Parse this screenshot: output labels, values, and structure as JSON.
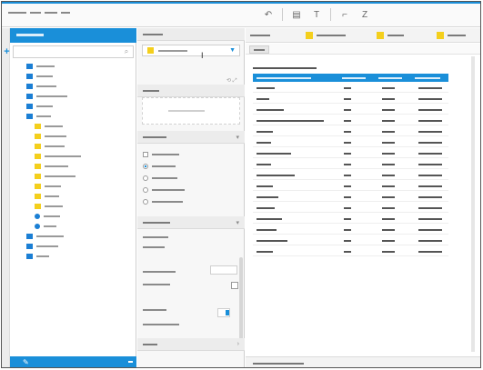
{
  "colors": {
    "accent": "#1a8fd9",
    "folder": "#1b7fd4",
    "field": "#f4cf1c",
    "legend": [
      "#f4cf1c",
      "#f4cf1c",
      "#f4cf1c"
    ]
  },
  "icons": {
    "add": "plus-icon",
    "search": "search-icon",
    "folder": "folder-icon",
    "field": "field-icon",
    "measure": "measure-icon",
    "edit": "pencil-icon",
    "dropdown": "chevron-down-icon"
  },
  "data_panel": {
    "search_placeholder": "",
    "tree": [
      {
        "type": "folder",
        "indent": 0
      },
      {
        "type": "folder",
        "indent": 0
      },
      {
        "type": "folder",
        "indent": 0
      },
      {
        "type": "folder",
        "indent": 0
      },
      {
        "type": "folder",
        "indent": 0
      },
      {
        "type": "folder",
        "indent": 0
      },
      {
        "type": "field",
        "indent": 1
      },
      {
        "type": "field",
        "indent": 1
      },
      {
        "type": "field",
        "indent": 1
      },
      {
        "type": "field",
        "indent": 1
      },
      {
        "type": "field",
        "indent": 1
      },
      {
        "type": "field",
        "indent": 1
      },
      {
        "type": "field",
        "indent": 1
      },
      {
        "type": "field",
        "indent": 1
      },
      {
        "type": "field",
        "indent": 1
      },
      {
        "type": "measure",
        "indent": 1
      },
      {
        "type": "measure",
        "indent": 1
      },
      {
        "type": "folder",
        "indent": 0
      },
      {
        "type": "folder",
        "indent": 0
      },
      {
        "type": "folder",
        "indent": 0
      }
    ]
  },
  "config_panel": {
    "options": [
      {
        "kind": "check"
      },
      {
        "kind": "radio",
        "selected": true
      },
      {
        "kind": "radio"
      },
      {
        "kind": "radio"
      },
      {
        "kind": "radio"
      }
    ],
    "format_rows": [
      {},
      {},
      {},
      {},
      {},
      {}
    ],
    "number_input_value": ""
  },
  "report": {
    "legend": [
      {},
      {},
      {}
    ],
    "columns": [
      {},
      {},
      {},
      {}
    ],
    "rows": [
      {},
      {},
      {},
      {},
      {},
      {},
      {},
      {},
      {},
      {},
      {},
      {},
      {},
      {},
      {},
      {}
    ],
    "status": ""
  }
}
